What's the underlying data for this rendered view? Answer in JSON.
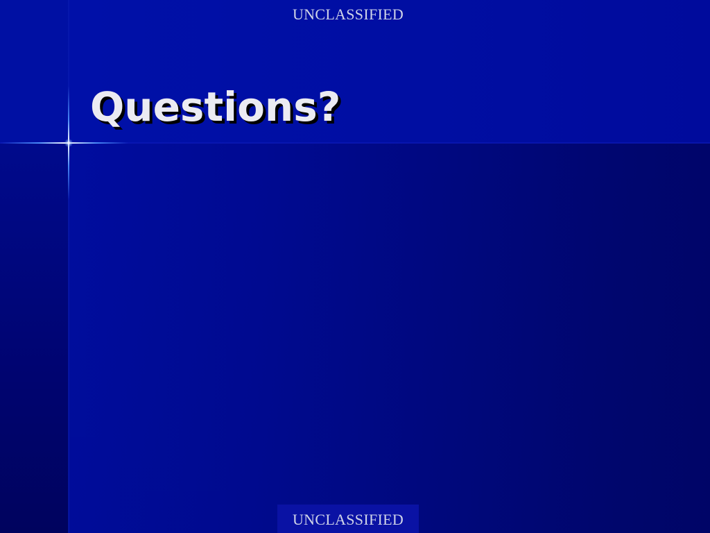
{
  "slide": {
    "title": "Questions?",
    "classification_top": "UNCLASSIFIED",
    "classification_bottom": "UNCLASSIFIED"
  },
  "colors": {
    "background": "#000a92",
    "title_band": "#0010a8",
    "title_text": "#ebebf2",
    "classification_text": "#d0d4e8",
    "sparkle": "#ffffff"
  },
  "decorations": {
    "corner_accent": "sparkle-icon"
  }
}
